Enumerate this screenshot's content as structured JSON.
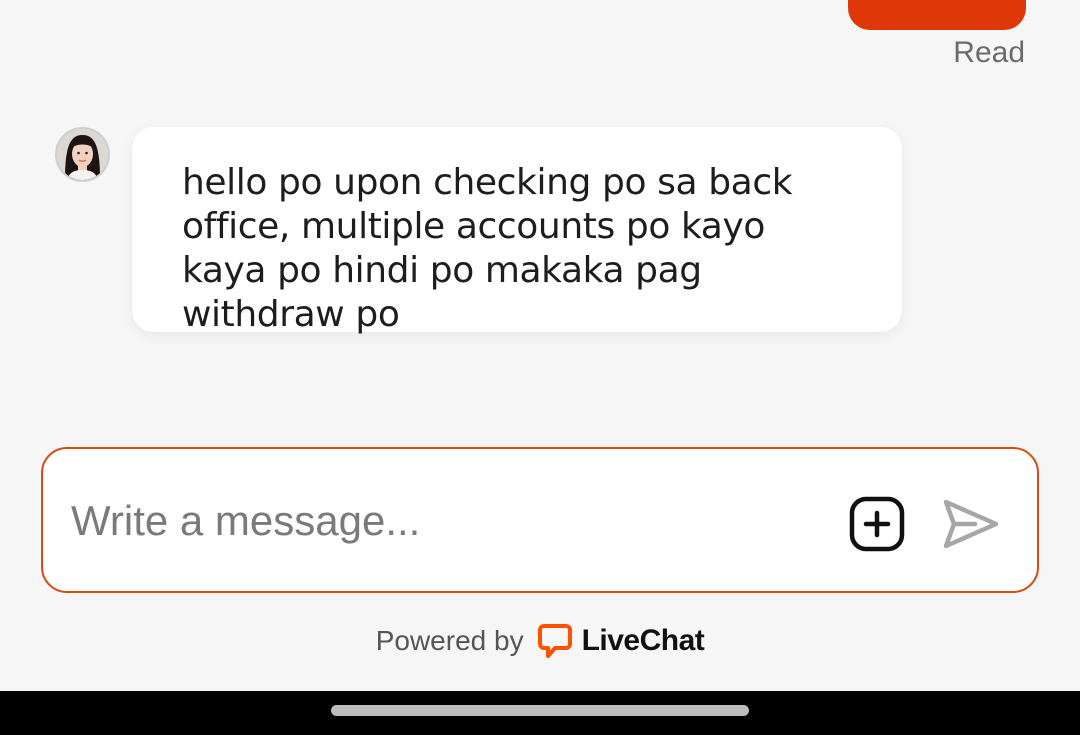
{
  "conversation": {
    "outgoing_status": "Read",
    "incoming_message": "hello po upon checking po sa back office, multiple accounts po kayo kaya po hindi po makaka pag withdraw po"
  },
  "composer": {
    "placeholder": "Write a message...",
    "value": "",
    "attach_icon": "plus-square-icon",
    "send_icon": "send-icon"
  },
  "footer": {
    "powered_by": "Powered by",
    "brand": "LiveChat",
    "brand_icon": "livechat-logo-icon"
  },
  "colors": {
    "accent": "#de3808",
    "composer_border": "#d84a14",
    "background": "#f6f6f6",
    "brand_logo": "#ff5100"
  }
}
